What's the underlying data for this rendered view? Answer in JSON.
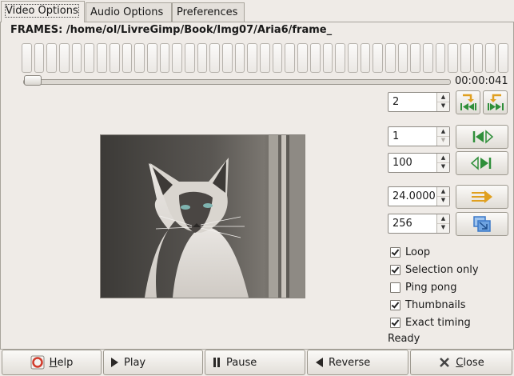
{
  "tabs": [
    {
      "label": "Video Options",
      "active": true
    },
    {
      "label": "Audio Options",
      "active": false
    },
    {
      "label": "Preferences",
      "active": false
    }
  ],
  "frames_label": "FRAMES: /home/ol/LivreGimp/Book/Img07/Aria6/frame_",
  "thumbnail_count": 39,
  "timecode": "00:00:041",
  "controls": {
    "step_value": "2",
    "from_frame": "1",
    "to_frame": "100",
    "fps": "24.0000",
    "size": "256"
  },
  "options": {
    "loop": {
      "label": "Loop",
      "checked": true
    },
    "selection_only": {
      "label": "Selection only",
      "checked": true
    },
    "ping_pong": {
      "label": "Ping pong",
      "checked": false
    },
    "thumbnails": {
      "label": "Thumbnails",
      "checked": true
    },
    "exact_timing": {
      "label": "Exact timing",
      "checked": true
    }
  },
  "status": "Ready",
  "buttons": {
    "help_accel": "H",
    "help_rest": "elp",
    "play": "Play",
    "pause": "Pause",
    "reverse": "Reverse",
    "close_accel": "C",
    "close_rest": "lose"
  },
  "colors": {
    "icon_green": "#2f8f3a",
    "icon_orange": "#e0a020",
    "icon_blue": "#3a78c8"
  }
}
